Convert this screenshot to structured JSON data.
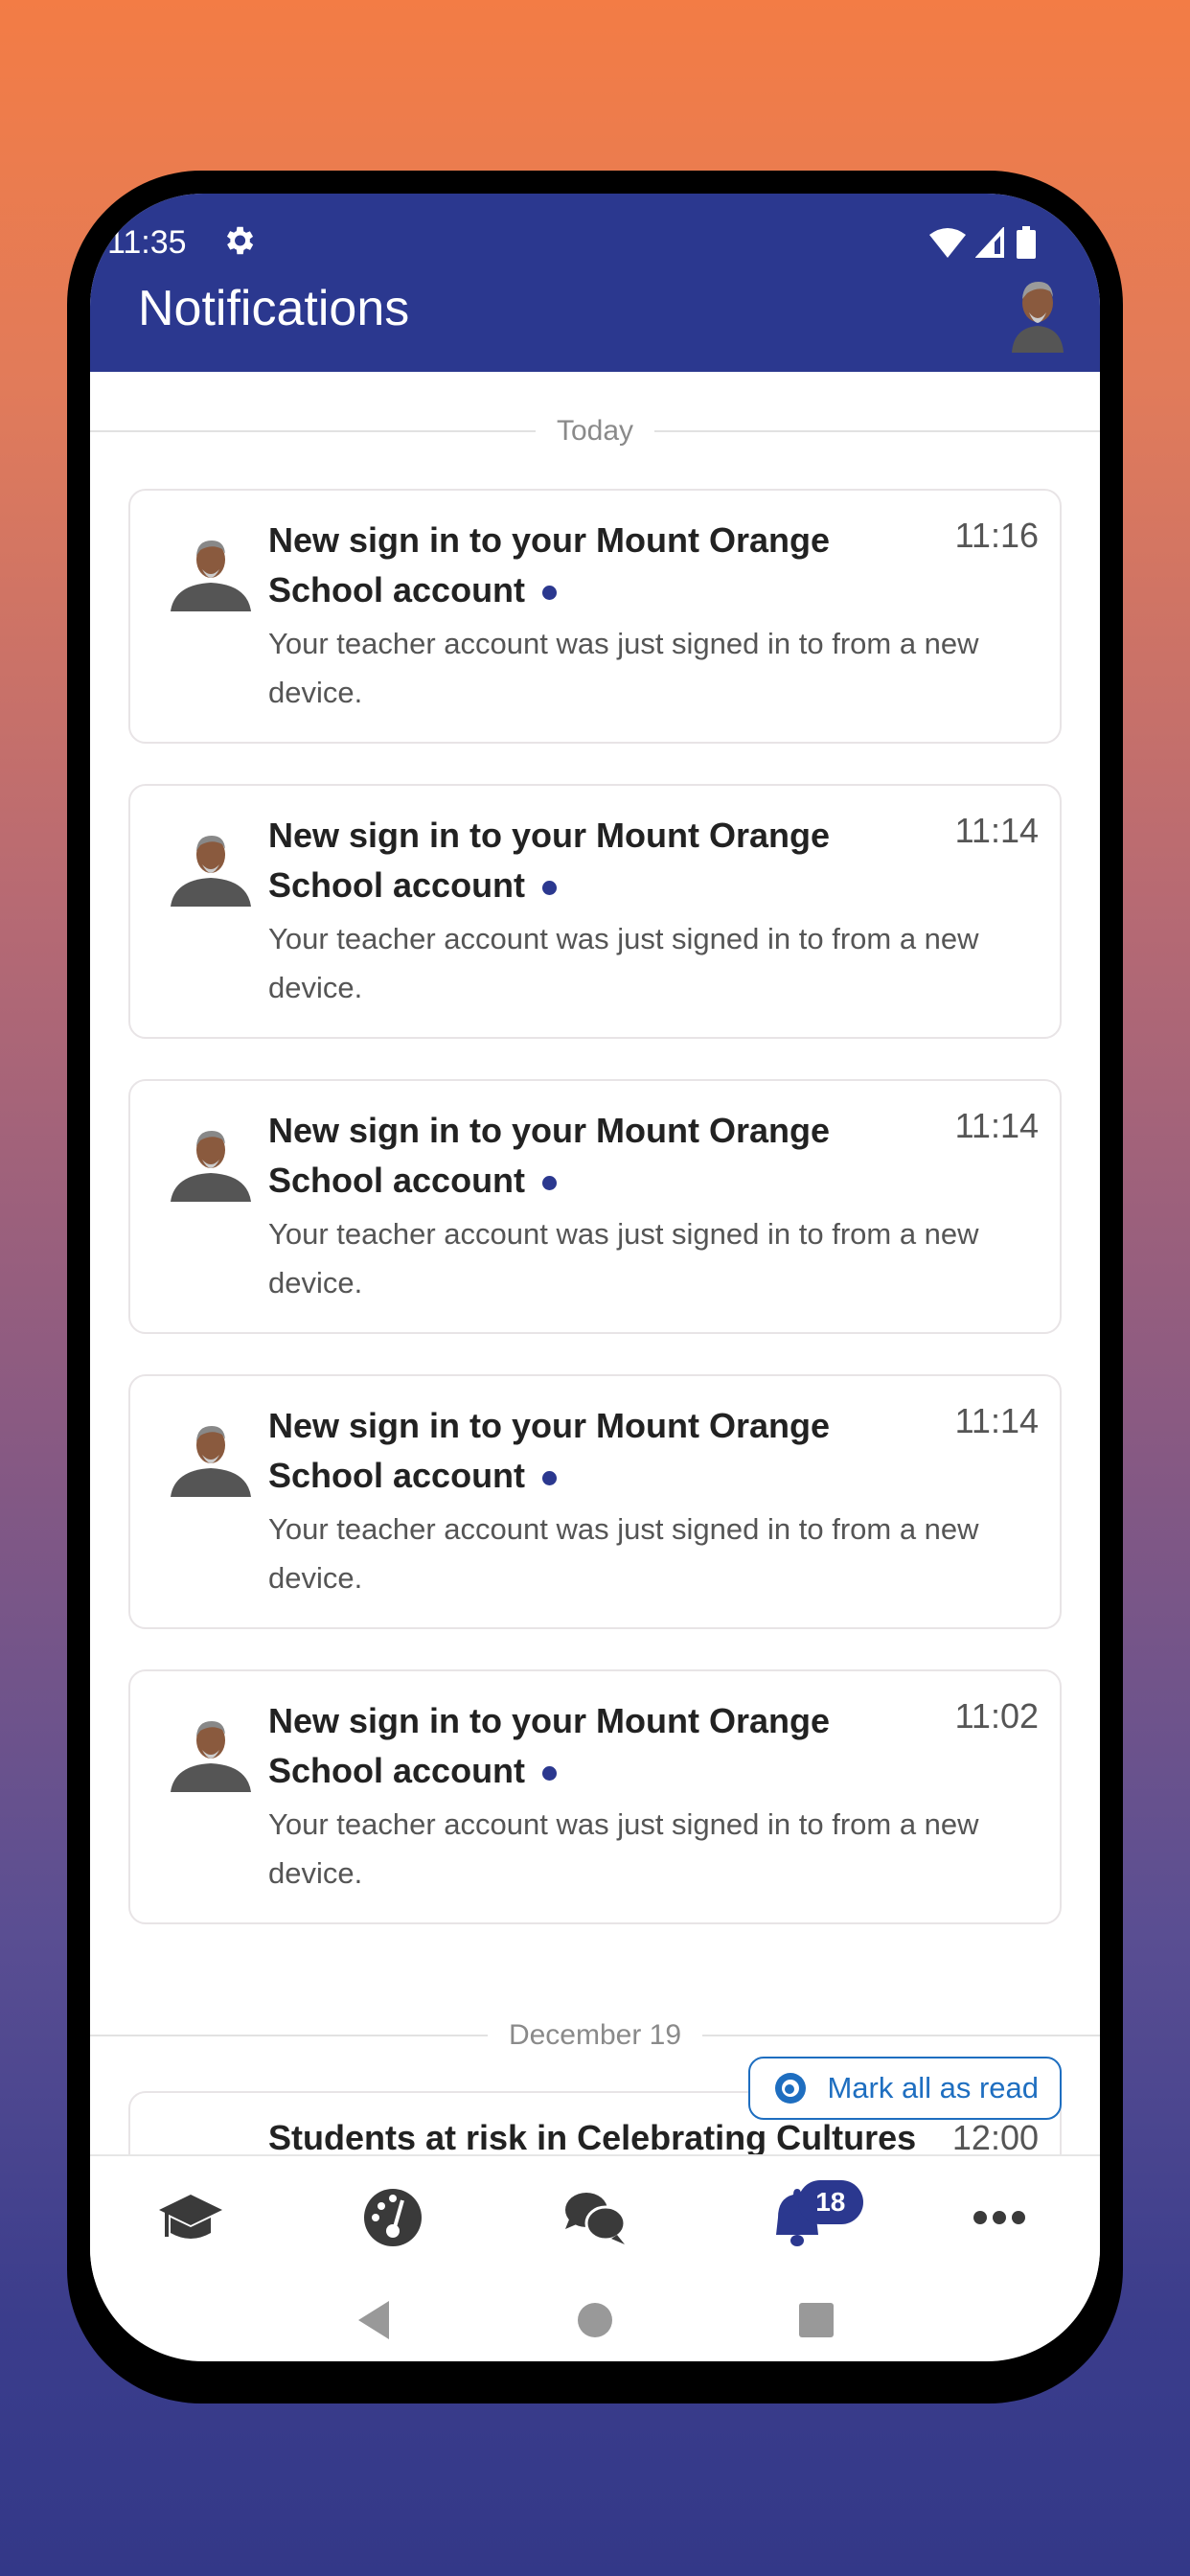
{
  "status_bar": {
    "time": "11:35",
    "icons": [
      "gear-icon",
      "wifi-icon",
      "signal-icon",
      "battery-icon"
    ]
  },
  "header": {
    "title": "Notifications",
    "avatar": "user-avatar"
  },
  "colors": {
    "brand": "#2b388f",
    "link": "#1e6ec0",
    "unread_dot": "#2b388f"
  },
  "sections": [
    {
      "label": "Today",
      "notifications": [
        {
          "title": "New sign in to your Mount Orange School account",
          "time": "11:16",
          "body": "Your teacher account was just signed in to from a new device.",
          "unread": true
        },
        {
          "title": "New sign in to your Mount Orange School account",
          "time": "11:14",
          "body": "Your teacher account was just signed in to from a new device.",
          "unread": true
        },
        {
          "title": "New sign in to your Mount Orange School account",
          "time": "11:14",
          "body": "Your teacher account was just signed in to from a new device.",
          "unread": true
        },
        {
          "title": "New sign in to your Mount Orange School account",
          "time": "11:14",
          "body": "Your teacher account was just signed in to from a new device.",
          "unread": true
        },
        {
          "title": "New sign in to your Mount Orange School account",
          "time": "11:02",
          "body": "Your teacher account was just signed in to from a new device.",
          "unread": true
        }
      ]
    },
    {
      "label": "December 19",
      "notifications": [
        {
          "title": "Students at risk in Celebrating Cultures",
          "time": "12:00"
        }
      ]
    }
  ],
  "mark_all": {
    "label": "Mark all as read",
    "icon": "eye-icon"
  },
  "tabs": [
    {
      "name": "my-courses",
      "icon": "graduation-cap-icon"
    },
    {
      "name": "dashboard",
      "icon": "dashboard-gauge-icon"
    },
    {
      "name": "messages",
      "icon": "chat-bubbles-icon"
    },
    {
      "name": "notifications",
      "icon": "bell-icon",
      "badge": "18",
      "active": true
    },
    {
      "name": "more",
      "icon": "more-dots-icon"
    }
  ],
  "system_nav": [
    "back-button",
    "home-button",
    "recents-button"
  ]
}
